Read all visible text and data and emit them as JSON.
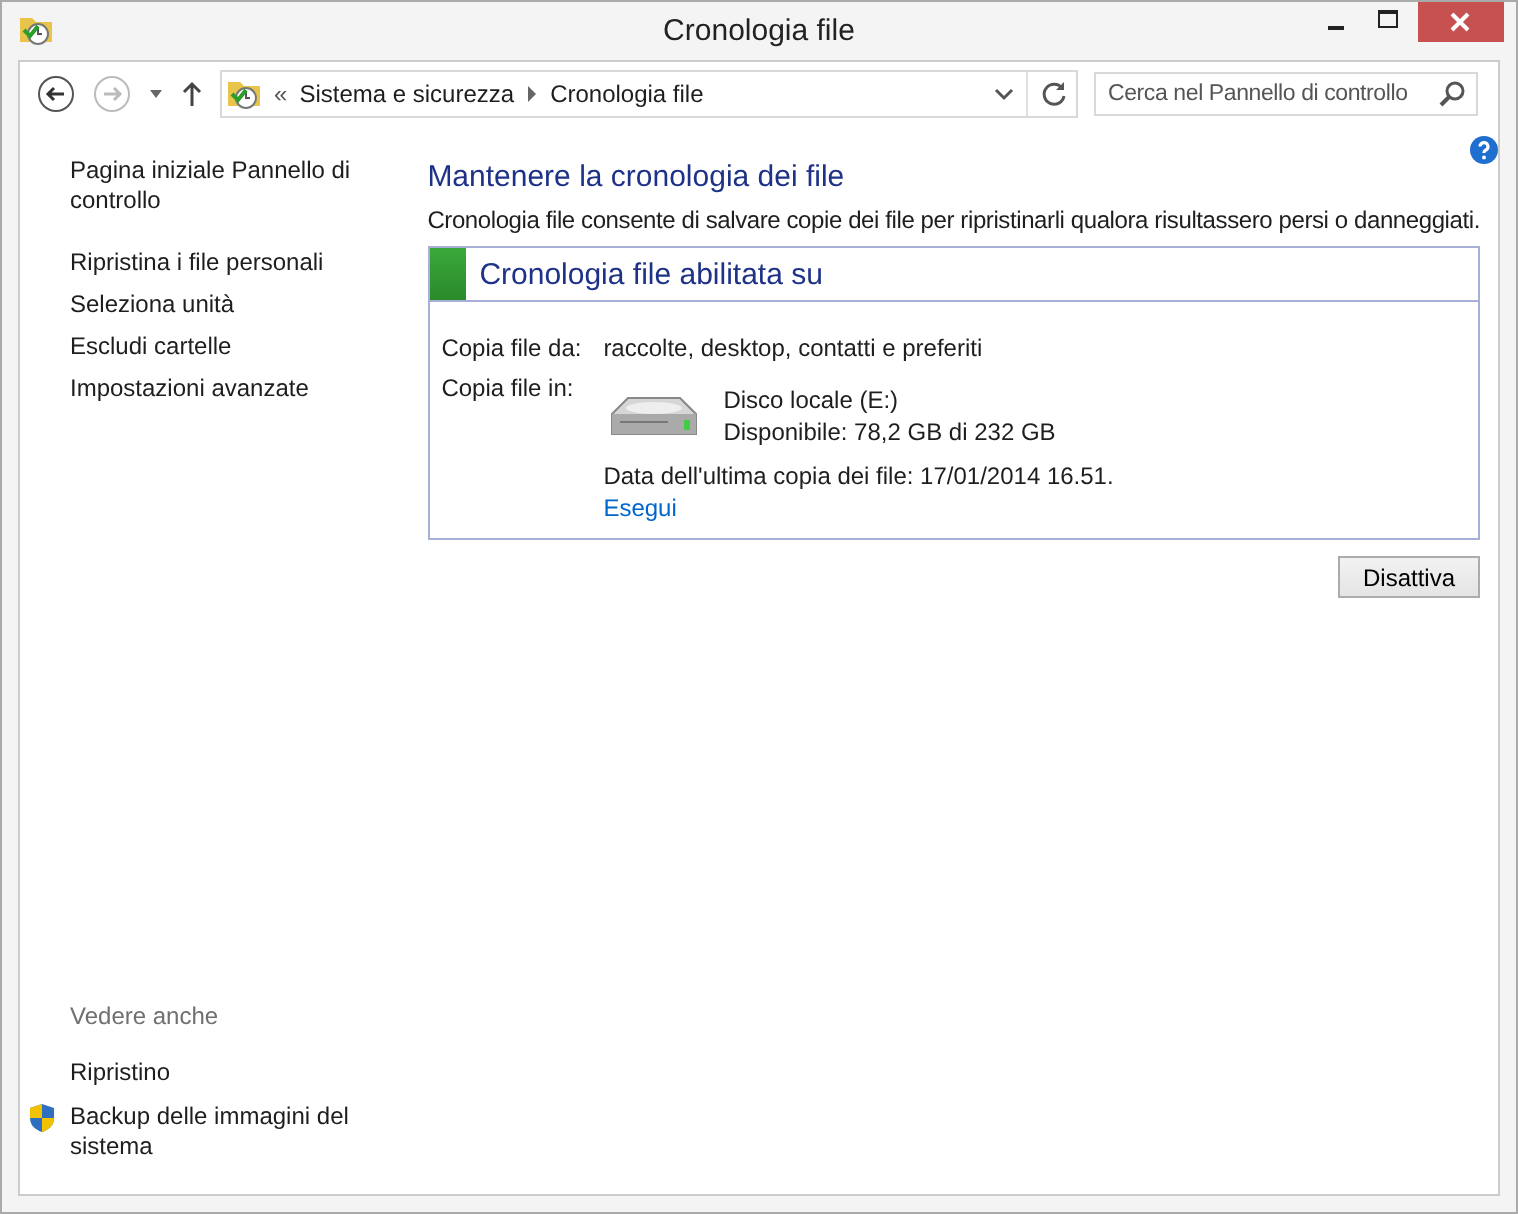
{
  "window": {
    "title": "Cronologia file"
  },
  "address_bar": {
    "prefix": "«",
    "crumbs": [
      "Sistema e sicurezza",
      "Cronologia file"
    ]
  },
  "search": {
    "placeholder": "Cerca nel Pannello di controllo"
  },
  "sidebar": {
    "items": [
      {
        "label": "Pagina iniziale Pannello di controllo"
      },
      {
        "label": "Ripristina i file personali"
      },
      {
        "label": "Seleziona unità"
      },
      {
        "label": "Escludi cartelle"
      },
      {
        "label": "Impostazioni avanzate"
      }
    ],
    "see_also_heading": "Vedere anche",
    "see_also": [
      {
        "label": "Ripristino",
        "kind": "plain"
      },
      {
        "label": "Backup delle immagini del sistema",
        "kind": "shield"
      }
    ]
  },
  "main": {
    "heading": "Mantenere la cronologia dei file",
    "description": "Cronologia file consente di salvare copie dei file per ripristinarli qualora risultassero persi o danneggiati.",
    "status_panel": {
      "title": "Cronologia file abilitata su",
      "on": true,
      "copy_from_label": "Copia file da:",
      "copy_from_value": "raccolte, desktop, contatti e preferiti",
      "copy_to_label": "Copia file in:",
      "drive_name": "Disco locale (E:)",
      "drive_space": "Disponibile: 78,2 GB di 232 GB",
      "last_copy": "Data dell'ultima copia dei file: 17/01/2014 16.51.",
      "run_link": "Esegui"
    },
    "button": "Disattiva"
  }
}
